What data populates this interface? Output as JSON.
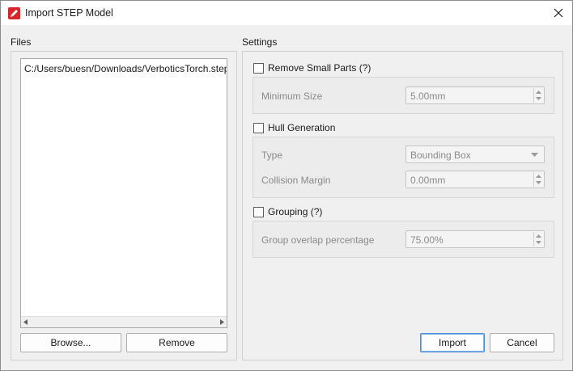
{
  "window": {
    "title": "Import STEP Model",
    "icon": "app-red-pencil-icon",
    "accent_color": "#d62828"
  },
  "files": {
    "label": "Files",
    "items": [
      "C:/Users/buesn/Downloads/VerboticsTorch.step"
    ],
    "browse_label": "Browse...",
    "remove_label": "Remove"
  },
  "settings": {
    "label": "Settings",
    "remove_small_parts": {
      "label": "Remove Small Parts (?)",
      "checked": false,
      "min_size_label": "Minimum Size",
      "min_size_value": "5.00mm"
    },
    "hull_generation": {
      "label": "Hull Generation",
      "checked": false,
      "type_label": "Type",
      "type_value": "Bounding Box",
      "margin_label": "Collision Margin",
      "margin_value": "0.00mm"
    },
    "grouping": {
      "label": "Grouping (?)",
      "checked": false,
      "overlap_label": "Group overlap percentage",
      "overlap_value": "75.00%"
    }
  },
  "actions": {
    "import_label": "Import",
    "cancel_label": "Cancel"
  }
}
